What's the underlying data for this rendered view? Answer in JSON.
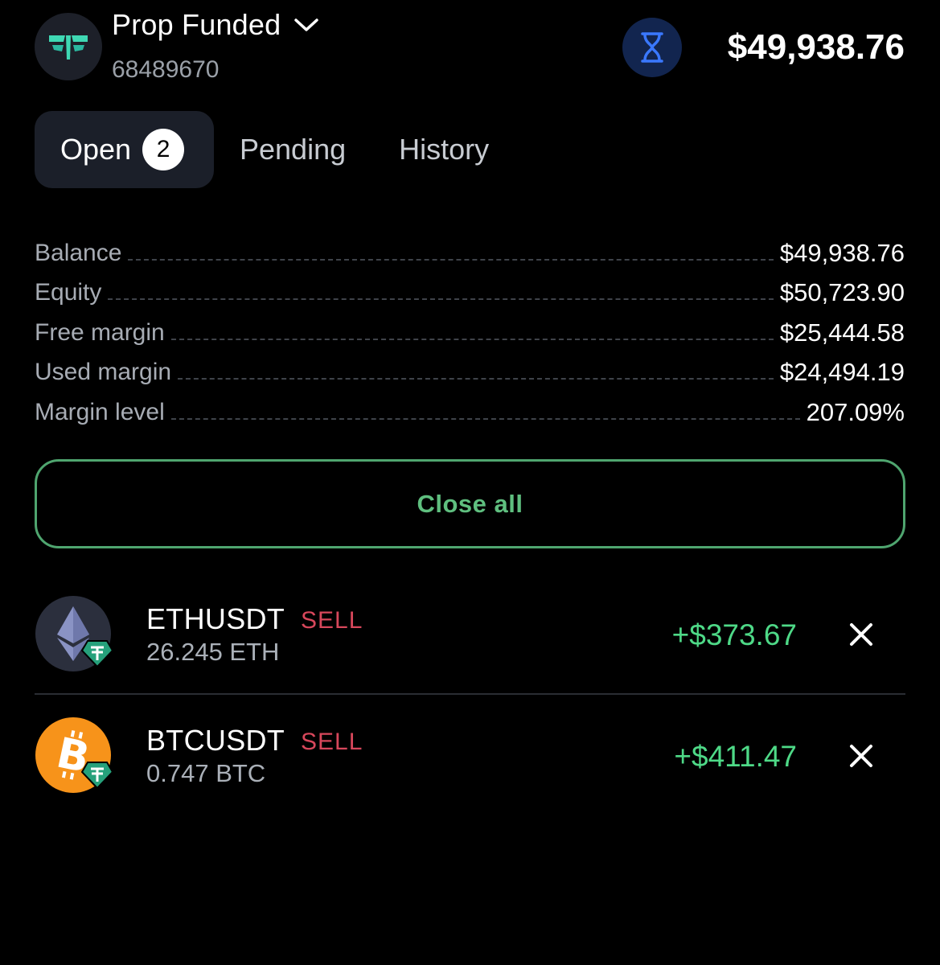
{
  "header": {
    "account_name": "Prop Funded",
    "account_id": "68489670",
    "balance": "$49,938.76",
    "logo_icon": "prop-funded-logo",
    "status_icon": "hourglass-icon",
    "dropdown_icon": "chevron-down-icon"
  },
  "tabs": [
    {
      "label": "Open",
      "count": "2",
      "active": true
    },
    {
      "label": "Pending",
      "active": false
    },
    {
      "label": "History",
      "active": false
    }
  ],
  "stats": [
    {
      "label": "Balance",
      "value": "$49,938.76"
    },
    {
      "label": "Equity",
      "value": "$50,723.90"
    },
    {
      "label": "Free margin",
      "value": "$25,444.58"
    },
    {
      "label": "Used margin",
      "value": "$24,494.19"
    },
    {
      "label": "Margin level",
      "value": "207.09%"
    }
  ],
  "close_all_label": "Close all",
  "positions": [
    {
      "symbol": "ETHUSDT",
      "side": "SELL",
      "volume": "26.245 ETH",
      "pnl": "+$373.67",
      "icon": "ethereum-icon",
      "badge_icon": "tether-icon"
    },
    {
      "symbol": "BTCUSDT",
      "side": "SELL",
      "volume": "0.747 BTC",
      "pnl": "+$411.47",
      "icon": "bitcoin-icon",
      "badge_icon": "tether-icon"
    }
  ],
  "colors": {
    "background": "#000000",
    "accent_green": "#5fbf7f",
    "profit_green": "#4ed987",
    "sell_red": "#d7475b",
    "tab_active_bg": "#1b1f29",
    "hourglass_blue": "#2f6cf0"
  }
}
